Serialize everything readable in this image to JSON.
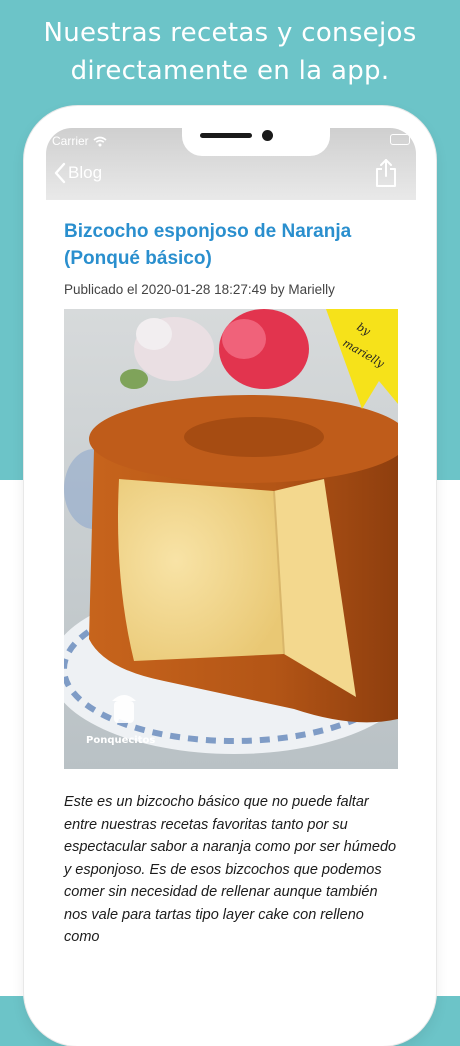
{
  "promo": {
    "line1": "Nuestras recetas y consejos",
    "line2": "directamente en la app."
  },
  "status_bar": {
    "carrier": "Carrier",
    "wifi_icon": "wifi-icon",
    "battery_icon": "battery-icon"
  },
  "nav": {
    "back_label": "Blog",
    "back_icon": "chevron-left-icon",
    "share_icon": "share-icon"
  },
  "article": {
    "title": "Bizcocho esponjoso de Naranja (Ponqué básico)",
    "meta": "Publicado el 2020-01-28 18:27:49 by Marielly",
    "image": {
      "badge_line1": "by",
      "badge_line2": "marielly",
      "watermark": "Ponquecitos"
    },
    "body": "Este es un bizcocho básico que no puede faltar entre nuestras recetas favoritas tanto por su espectacular sabor a naranja como por ser húmedo y esponjoso. Es de esos bizcochos que podemos comer sin necesidad de rellenar aunque también nos vale para tartas tipo layer cake con relleno como"
  },
  "colors": {
    "background_teal": "#6cc4c8",
    "title_blue": "#2a8fce",
    "badge_yellow": "#f6e21a"
  }
}
